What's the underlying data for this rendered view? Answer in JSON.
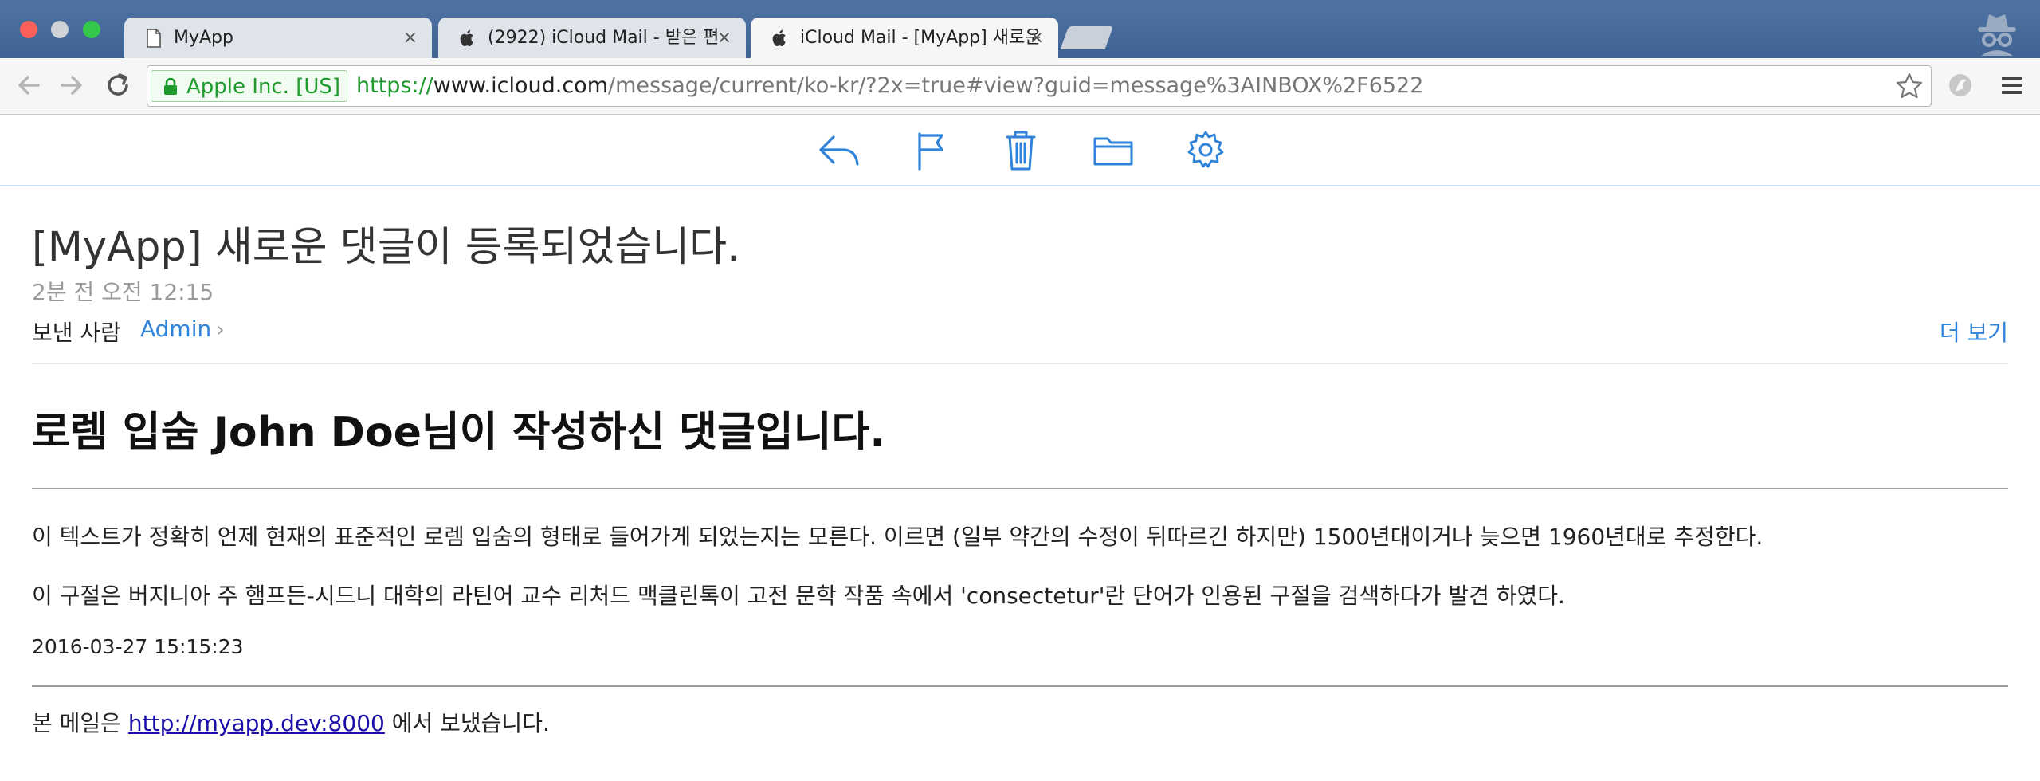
{
  "browser": {
    "tabs": [
      {
        "title": "MyApp",
        "icon": "page-icon",
        "close": "×"
      },
      {
        "title": "(2922) iCloud Mail - 받은 편",
        "icon": "apple-icon",
        "close": "×"
      },
      {
        "title": "iCloud Mail - [MyApp] 새로운",
        "icon": "apple-icon",
        "close": "×"
      }
    ],
    "active_tab": 2,
    "ev_certificate": "Apple Inc. [US]",
    "url": {
      "scheme": "https://",
      "host": "www.icloud.com",
      "path": "/message/current/ko-kr/?2x=true#view?guid=message%3AINBOX%2F6522"
    }
  },
  "mail_toolbar": {
    "icons": [
      "reply-icon",
      "flag-icon",
      "trash-icon",
      "folder-icon",
      "gear-icon"
    ],
    "accent": "#2f83d9"
  },
  "message": {
    "subject": "[MyApp] 새로운 댓글이 등록되었습니다.",
    "timestamp": "2분 전 오전 12:15",
    "from_label": "보낸 사람",
    "sender": "Admin",
    "sender_chevron": "›",
    "more_label": "더 보기",
    "body": {
      "heading": "로렘 입숨 John Doe님이 작성하신 댓글입니다.",
      "paragraphs": [
        "이 텍스트가 정확히 언제 현재의 표준적인 로렘 입숨의 형태로 들어가게 되었는지는 모른다. 이르면 (일부 약간의 수정이 뒤따르긴 하지만) 1500년대이거나 늦으면 1960년대로 추정한다.",
        "이 구절은 버지니아 주 햄프든-시드니 대학의 라틴어 교수 리처드 맥클린톡이 고전 문학 작품 속에서 'consectetur'란 단어가 인용된 구절을 검색하다가 발견 하였다."
      ],
      "date": "2016-03-27 15:15:23",
      "footer_prefix": "본 메일은",
      "footer_link": "http://myapp.dev:8000",
      "footer_suffix": "에서 보냈습니다."
    }
  }
}
